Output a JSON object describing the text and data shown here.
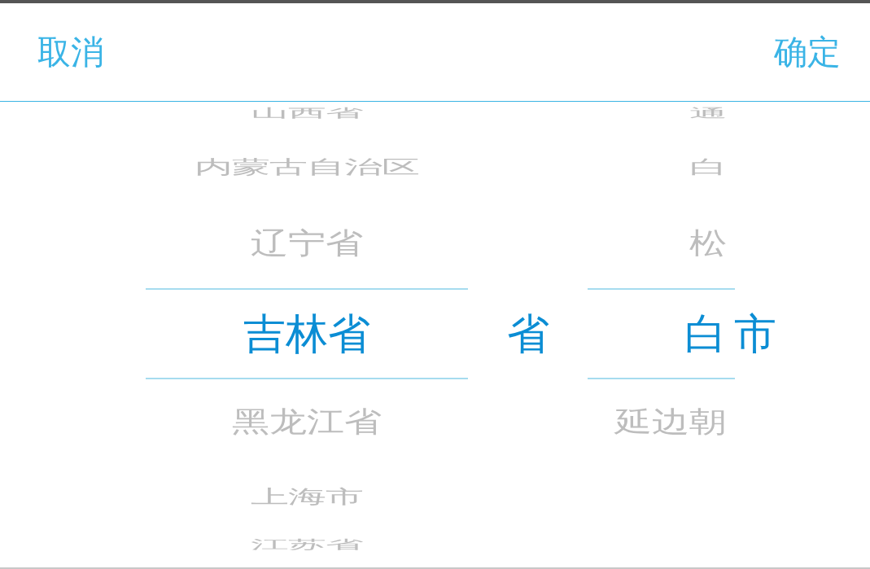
{
  "header": {
    "cancel": "取消",
    "confirm": "确定"
  },
  "wheels": [
    {
      "items": [
        {
          "label": "山西省",
          "selected": false
        },
        {
          "label": "内蒙古自治区",
          "selected": false
        },
        {
          "label": "辽宁省",
          "selected": false
        },
        {
          "label": "吉林省",
          "selected": true
        },
        {
          "label": "黑龙江省",
          "selected": false
        },
        {
          "label": "上海市",
          "selected": false
        },
        {
          "label": "江苏省",
          "selected": false
        }
      ],
      "unit": "省"
    },
    {
      "items": [
        {
          "label": "通",
          "selected": false
        },
        {
          "label": "白",
          "selected": false
        },
        {
          "label": "松",
          "selected": false
        },
        {
          "label": "白",
          "selected": true
        },
        {
          "label": "延边朝",
          "selected": false
        }
      ],
      "unit": "市"
    }
  ]
}
